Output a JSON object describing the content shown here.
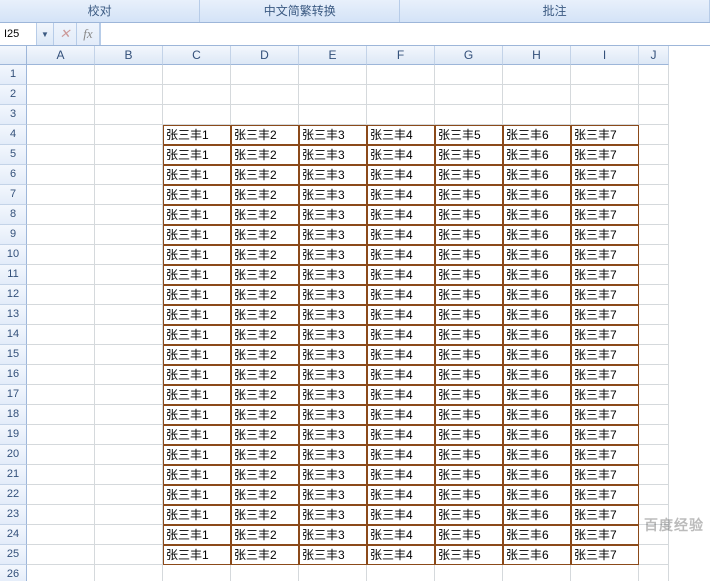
{
  "ribbon_tabs": [
    "校对",
    "中文简繁转换",
    "批注"
  ],
  "name_box": "I25",
  "formula_value": "",
  "columns": [
    "A",
    "B",
    "C",
    "D",
    "E",
    "F",
    "G",
    "H",
    "I",
    "J"
  ],
  "row_count": 26,
  "data_region": {
    "start_row": 4,
    "end_row": 25,
    "start_col_index": 2,
    "series": [
      "张三丰1",
      "张三丰2",
      "张三丰3",
      "张三丰4",
      "张三丰5",
      "张三丰6",
      "张三丰7"
    ]
  },
  "watermark_hint": "百度经验",
  "icons": {
    "dropdown": "▼",
    "cancel": "✕",
    "fx": "fx"
  },
  "chart_data": {
    "type": "table",
    "title": "",
    "columns": [
      "C",
      "D",
      "E",
      "F",
      "G",
      "H",
      "I"
    ],
    "rows_range": "4-25",
    "row_template": [
      "张三丰1",
      "张三丰2",
      "张三丰3",
      "张三丰4",
      "张三丰5",
      "张三丰6",
      "张三丰7"
    ],
    "repeat_rows": 22
  }
}
